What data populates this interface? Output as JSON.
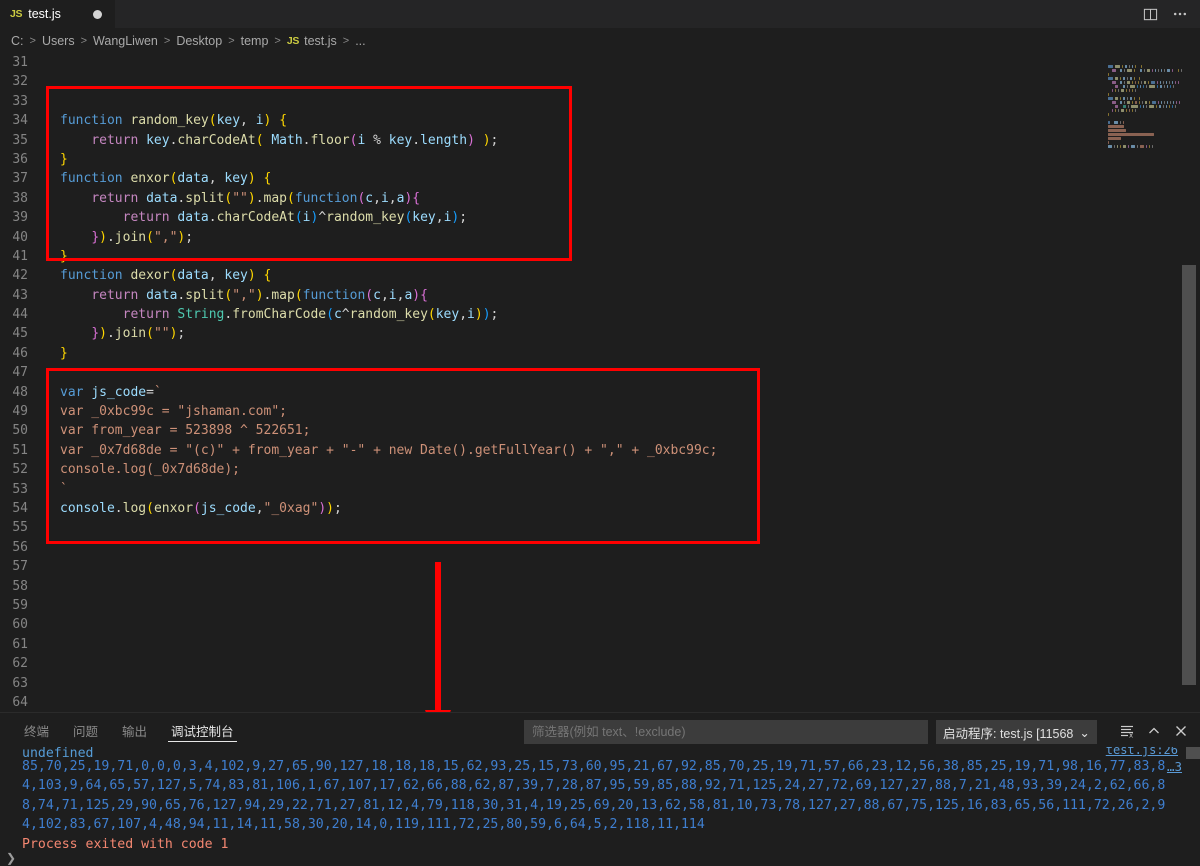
{
  "window": {
    "tab": {
      "label": "test.js",
      "badge": "JS",
      "dirty": true
    },
    "actions": {
      "split_editor": "split-editor",
      "more": "..."
    }
  },
  "breadcrumb": {
    "items": [
      "C:",
      "Users",
      "WangLiwen",
      "Desktop",
      "temp",
      "test.js",
      "..."
    ],
    "file_badge": "JS",
    "separator": ">"
  },
  "editor": {
    "first_line": 31,
    "lines": [
      {
        "n": 31,
        "tokens": []
      },
      {
        "n": 32,
        "tokens": []
      },
      {
        "n": 33,
        "tokens": []
      },
      {
        "n": 34,
        "tokens": [
          {
            "t": "function ",
            "c": "k"
          },
          {
            "t": "random_key",
            "c": "fn"
          },
          {
            "t": "(",
            "c": "p1"
          },
          {
            "t": "key",
            "c": "va"
          },
          {
            "t": ", ",
            "c": "br"
          },
          {
            "t": "i",
            "c": "va"
          },
          {
            "t": ")",
            "c": "p1"
          },
          {
            "t": " ",
            "c": "br"
          },
          {
            "t": "{",
            "c": "p1"
          }
        ]
      },
      {
        "n": 35,
        "tokens": [
          {
            "t": "    ",
            "c": "br"
          },
          {
            "t": "return",
            "c": "kc"
          },
          {
            "t": " ",
            "c": "br"
          },
          {
            "t": "key",
            "c": "va"
          },
          {
            "t": ".",
            "c": "br"
          },
          {
            "t": "charCodeAt",
            "c": "fn"
          },
          {
            "t": "(",
            "c": "p1"
          },
          {
            "t": " ",
            "c": "br"
          },
          {
            "t": "Math",
            "c": "va"
          },
          {
            "t": ".",
            "c": "br"
          },
          {
            "t": "floor",
            "c": "fn"
          },
          {
            "t": "(",
            "c": "p2"
          },
          {
            "t": "i",
            "c": "va"
          },
          {
            "t": " % ",
            "c": "br"
          },
          {
            "t": "key",
            "c": "va"
          },
          {
            "t": ".",
            "c": "br"
          },
          {
            "t": "length",
            "c": "va"
          },
          {
            "t": ")",
            "c": "p2"
          },
          {
            "t": " ",
            "c": "br"
          },
          {
            "t": ")",
            "c": "p1"
          },
          {
            "t": ";",
            "c": "br"
          }
        ]
      },
      {
        "n": 36,
        "tokens": [
          {
            "t": "}",
            "c": "p1"
          }
        ]
      },
      {
        "n": 37,
        "tokens": [
          {
            "t": "function ",
            "c": "k"
          },
          {
            "t": "enxor",
            "c": "fn"
          },
          {
            "t": "(",
            "c": "p1"
          },
          {
            "t": "data",
            "c": "va"
          },
          {
            "t": ", ",
            "c": "br"
          },
          {
            "t": "key",
            "c": "va"
          },
          {
            "t": ")",
            "c": "p1"
          },
          {
            "t": " ",
            "c": "br"
          },
          {
            "t": "{",
            "c": "p1"
          }
        ]
      },
      {
        "n": 38,
        "tokens": [
          {
            "t": "    ",
            "c": "br"
          },
          {
            "t": "return",
            "c": "kc"
          },
          {
            "t": " ",
            "c": "br"
          },
          {
            "t": "data",
            "c": "va"
          },
          {
            "t": ".",
            "c": "br"
          },
          {
            "t": "split",
            "c": "fn"
          },
          {
            "t": "(",
            "c": "p1"
          },
          {
            "t": "\"\"",
            "c": "st"
          },
          {
            "t": ")",
            "c": "p1"
          },
          {
            "t": ".",
            "c": "br"
          },
          {
            "t": "map",
            "c": "fn"
          },
          {
            "t": "(",
            "c": "p1"
          },
          {
            "t": "function",
            "c": "k"
          },
          {
            "t": "(",
            "c": "p2"
          },
          {
            "t": "c",
            "c": "va"
          },
          {
            "t": ",",
            "c": "br"
          },
          {
            "t": "i",
            "c": "va"
          },
          {
            "t": ",",
            "c": "br"
          },
          {
            "t": "a",
            "c": "va"
          },
          {
            "t": ")",
            "c": "p2"
          },
          {
            "t": "{",
            "c": "p2"
          }
        ]
      },
      {
        "n": 39,
        "tokens": [
          {
            "t": "        ",
            "c": "br"
          },
          {
            "t": "return",
            "c": "kc"
          },
          {
            "t": " ",
            "c": "br"
          },
          {
            "t": "data",
            "c": "va"
          },
          {
            "t": ".",
            "c": "br"
          },
          {
            "t": "charCodeAt",
            "c": "fn"
          },
          {
            "t": "(",
            "c": "p3"
          },
          {
            "t": "i",
            "c": "va"
          },
          {
            "t": ")",
            "c": "p3"
          },
          {
            "t": "^",
            "c": "br"
          },
          {
            "t": "random_key",
            "c": "fn"
          },
          {
            "t": "(",
            "c": "p3"
          },
          {
            "t": "key",
            "c": "va"
          },
          {
            "t": ",",
            "c": "br"
          },
          {
            "t": "i",
            "c": "va"
          },
          {
            "t": ")",
            "c": "p3"
          },
          {
            "t": ";",
            "c": "br"
          }
        ]
      },
      {
        "n": 40,
        "tokens": [
          {
            "t": "    ",
            "c": "br"
          },
          {
            "t": "}",
            "c": "p2"
          },
          {
            "t": ")",
            "c": "p1"
          },
          {
            "t": ".",
            "c": "br"
          },
          {
            "t": "join",
            "c": "fn"
          },
          {
            "t": "(",
            "c": "p1"
          },
          {
            "t": "\",\"",
            "c": "st"
          },
          {
            "t": ")",
            "c": "p1"
          },
          {
            "t": ";",
            "c": "br"
          }
        ]
      },
      {
        "n": 41,
        "tokens": [
          {
            "t": "}",
            "c": "p1"
          }
        ]
      },
      {
        "n": 42,
        "tokens": [
          {
            "t": "function ",
            "c": "k"
          },
          {
            "t": "dexor",
            "c": "fn"
          },
          {
            "t": "(",
            "c": "p1"
          },
          {
            "t": "data",
            "c": "va"
          },
          {
            "t": ", ",
            "c": "br"
          },
          {
            "t": "key",
            "c": "va"
          },
          {
            "t": ")",
            "c": "p1"
          },
          {
            "t": " ",
            "c": "br"
          },
          {
            "t": "{",
            "c": "p1"
          }
        ]
      },
      {
        "n": 43,
        "tokens": [
          {
            "t": "    ",
            "c": "br"
          },
          {
            "t": "return",
            "c": "kc"
          },
          {
            "t": " ",
            "c": "br"
          },
          {
            "t": "data",
            "c": "va"
          },
          {
            "t": ".",
            "c": "br"
          },
          {
            "t": "split",
            "c": "fn"
          },
          {
            "t": "(",
            "c": "p1"
          },
          {
            "t": "\",\"",
            "c": "st"
          },
          {
            "t": ")",
            "c": "p1"
          },
          {
            "t": ".",
            "c": "br"
          },
          {
            "t": "map",
            "c": "fn"
          },
          {
            "t": "(",
            "c": "p1"
          },
          {
            "t": "function",
            "c": "k"
          },
          {
            "t": "(",
            "c": "p2"
          },
          {
            "t": "c",
            "c": "va"
          },
          {
            "t": ",",
            "c": "br"
          },
          {
            "t": "i",
            "c": "va"
          },
          {
            "t": ",",
            "c": "br"
          },
          {
            "t": "a",
            "c": "va"
          },
          {
            "t": ")",
            "c": "p2"
          },
          {
            "t": "{",
            "c": "p2"
          }
        ]
      },
      {
        "n": 44,
        "tokens": [
          {
            "t": "        ",
            "c": "br"
          },
          {
            "t": "return",
            "c": "kc"
          },
          {
            "t": " ",
            "c": "br"
          },
          {
            "t": "String",
            "c": "ty"
          },
          {
            "t": ".",
            "c": "br"
          },
          {
            "t": "fromCharCode",
            "c": "fn"
          },
          {
            "t": "(",
            "c": "p3"
          },
          {
            "t": "c",
            "c": "va"
          },
          {
            "t": "^",
            "c": "br"
          },
          {
            "t": "random_key",
            "c": "fn"
          },
          {
            "t": "(",
            "c": "p1"
          },
          {
            "t": "key",
            "c": "va"
          },
          {
            "t": ",",
            "c": "br"
          },
          {
            "t": "i",
            "c": "va"
          },
          {
            "t": ")",
            "c": "p1"
          },
          {
            "t": ")",
            "c": "p3"
          },
          {
            "t": ";",
            "c": "br"
          }
        ]
      },
      {
        "n": 45,
        "tokens": [
          {
            "t": "    ",
            "c": "br"
          },
          {
            "t": "}",
            "c": "p2"
          },
          {
            "t": ")",
            "c": "p1"
          },
          {
            "t": ".",
            "c": "br"
          },
          {
            "t": "join",
            "c": "fn"
          },
          {
            "t": "(",
            "c": "p1"
          },
          {
            "t": "\"\"",
            "c": "st"
          },
          {
            "t": ")",
            "c": "p1"
          },
          {
            "t": ";",
            "c": "br"
          }
        ]
      },
      {
        "n": 46,
        "tokens": [
          {
            "t": "}",
            "c": "p1"
          }
        ]
      },
      {
        "n": 47,
        "tokens": []
      },
      {
        "n": 48,
        "tokens": [
          {
            "t": "var",
            "c": "k"
          },
          {
            "t": " ",
            "c": "br"
          },
          {
            "t": "js_code",
            "c": "va"
          },
          {
            "t": "=",
            "c": "br"
          },
          {
            "t": "`",
            "c": "st"
          }
        ]
      },
      {
        "n": 49,
        "tokens": [
          {
            "t": "var _0xbc99c = \"jshaman.com\";",
            "c": "st"
          }
        ]
      },
      {
        "n": 50,
        "tokens": [
          {
            "t": "var from_year = 523898 ^ 522651;",
            "c": "st"
          }
        ]
      },
      {
        "n": 51,
        "tokens": [
          {
            "t": "var _0x7d68de = \"(c)\" + from_year + \"-\" + new Date().getFullYear() + \",\" + _0xbc99c;",
            "c": "st"
          }
        ]
      },
      {
        "n": 52,
        "tokens": [
          {
            "t": "console.log(_0x7d68de);",
            "c": "st"
          }
        ]
      },
      {
        "n": 53,
        "tokens": [
          {
            "t": "`",
            "c": "st"
          }
        ]
      },
      {
        "n": 54,
        "tokens": [
          {
            "t": "console",
            "c": "va"
          },
          {
            "t": ".",
            "c": "br"
          },
          {
            "t": "log",
            "c": "fn"
          },
          {
            "t": "(",
            "c": "p1"
          },
          {
            "t": "enxor",
            "c": "fn"
          },
          {
            "t": "(",
            "c": "p2"
          },
          {
            "t": "js_code",
            "c": "va"
          },
          {
            "t": ",",
            "c": "br"
          },
          {
            "t": "\"_0xag\"",
            "c": "st"
          },
          {
            "t": ")",
            "c": "p2"
          },
          {
            "t": ")",
            "c": "p1"
          },
          {
            "t": ";",
            "c": "br"
          }
        ]
      },
      {
        "n": 55,
        "tokens": []
      },
      {
        "n": 56,
        "tokens": []
      },
      {
        "n": 57,
        "tokens": []
      },
      {
        "n": 58,
        "tokens": []
      },
      {
        "n": 59,
        "tokens": []
      },
      {
        "n": 60,
        "tokens": []
      },
      {
        "n": 61,
        "tokens": []
      },
      {
        "n": 62,
        "tokens": []
      },
      {
        "n": 63,
        "tokens": []
      },
      {
        "n": 64,
        "tokens": []
      }
    ],
    "annotations": {
      "box1": "highlight-enxor-function",
      "box2": "highlight-js-code-string",
      "arrow": "arrow-pointing-to-debug-console",
      "accent_color": "#ff0000"
    }
  },
  "panel": {
    "tabs": [
      {
        "label": "终端",
        "active": false
      },
      {
        "label": "问题",
        "active": false
      },
      {
        "label": "输出",
        "active": false
      },
      {
        "label": "调试控制台",
        "active": true
      }
    ],
    "filter": {
      "value": "",
      "placeholder": "筛选器(例如 text、!exclude)"
    },
    "session": {
      "label": "启动程序: test.js [11568",
      "caret": "⌄"
    },
    "actions": {
      "clear": "clear-console",
      "maximize": "maximize-panel",
      "close": "close-panel"
    },
    "console": {
      "partial_top": "undefined",
      "source_link": "test.js:26",
      "more_badge": "…3",
      "lines": [
        "85,70,25,19,71,0,0,0,3,4,102,9,27,65,90,127,18,18,18,15,62,93,25,15,73,60,95,21,67,92,85,70,25,19,71,57,66,23,12,56,38,85,25,19,71,98,16,77,83,8",
        "4,103,9,64,65,57,127,5,74,83,81,106,1,67,107,17,62,66,88,62,87,39,7,28,87,95,59,85,88,92,71,125,24,27,72,69,127,27,88,7,21,48,93,39,24,2,62,66,8",
        "8,74,71,125,29,90,65,76,127,94,29,22,71,27,81,12,4,79,118,30,31,4,19,25,69,20,13,62,58,81,10,73,78,127,27,88,67,75,125,16,83,65,56,111,72,26,2,9",
        "4,102,83,67,107,4,48,94,11,14,11,58,30,20,14,0,119,111,72,25,80,59,6,64,5,2,118,11,114"
      ],
      "exit_message": "Process exited with code 1",
      "prompt": "❯"
    }
  }
}
